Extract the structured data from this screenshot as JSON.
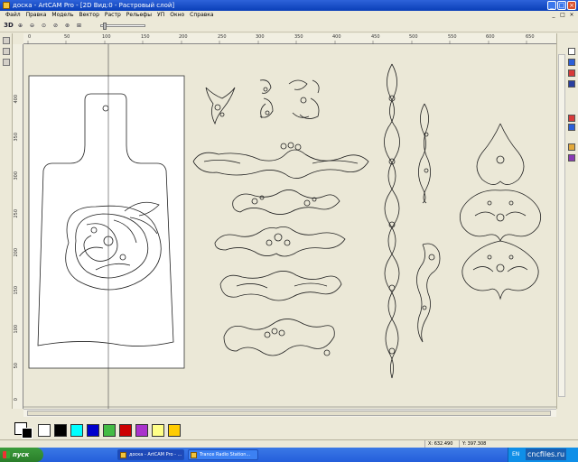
{
  "window": {
    "title": "доска - ArtCAM Pro - [2D Вид:0 - Растровый слой]",
    "min_label": "_",
    "max_label": "□",
    "close_label": "×"
  },
  "menu": {
    "items": [
      "Файл",
      "Правка",
      "Модель",
      "Вектор",
      "Растр",
      "Рельефы",
      "УП",
      "Окно",
      "Справка"
    ],
    "mdi_min": "_",
    "mdi_restore": "□",
    "mdi_close": "×"
  },
  "toolbar": {
    "view3d_label": "3D",
    "zoom_labels": [
      "⊕",
      "⊖",
      "⊙",
      "⊘",
      "⊛",
      "⊞"
    ]
  },
  "ruler_top": {
    "labels": [
      "0",
      "50",
      "100",
      "150",
      "200",
      "250",
      "300",
      "350",
      "400",
      "450",
      "500",
      "550",
      "600",
      "650"
    ]
  },
  "ruler_left": {
    "labels": [
      "400",
      "350",
      "300",
      "250",
      "200",
      "150",
      "100",
      "50",
      "0"
    ]
  },
  "palette": {
    "colors": [
      "#ffffff",
      "#000000",
      "#00ffff",
      "#0000cc",
      "#44bb44",
      "#cc0000",
      "#aa33cc",
      "#ffff88",
      "#ffcc00"
    ]
  },
  "status": {
    "x": "X: 632.490",
    "y": "Y: 397.308"
  },
  "taskbar": {
    "start_label": "пуск",
    "tasks": [
      "доска - ArtCAM Pro - ...",
      "Trance Radio Station..."
    ],
    "lang": "EN"
  },
  "watermark": "cncfiles.ru"
}
